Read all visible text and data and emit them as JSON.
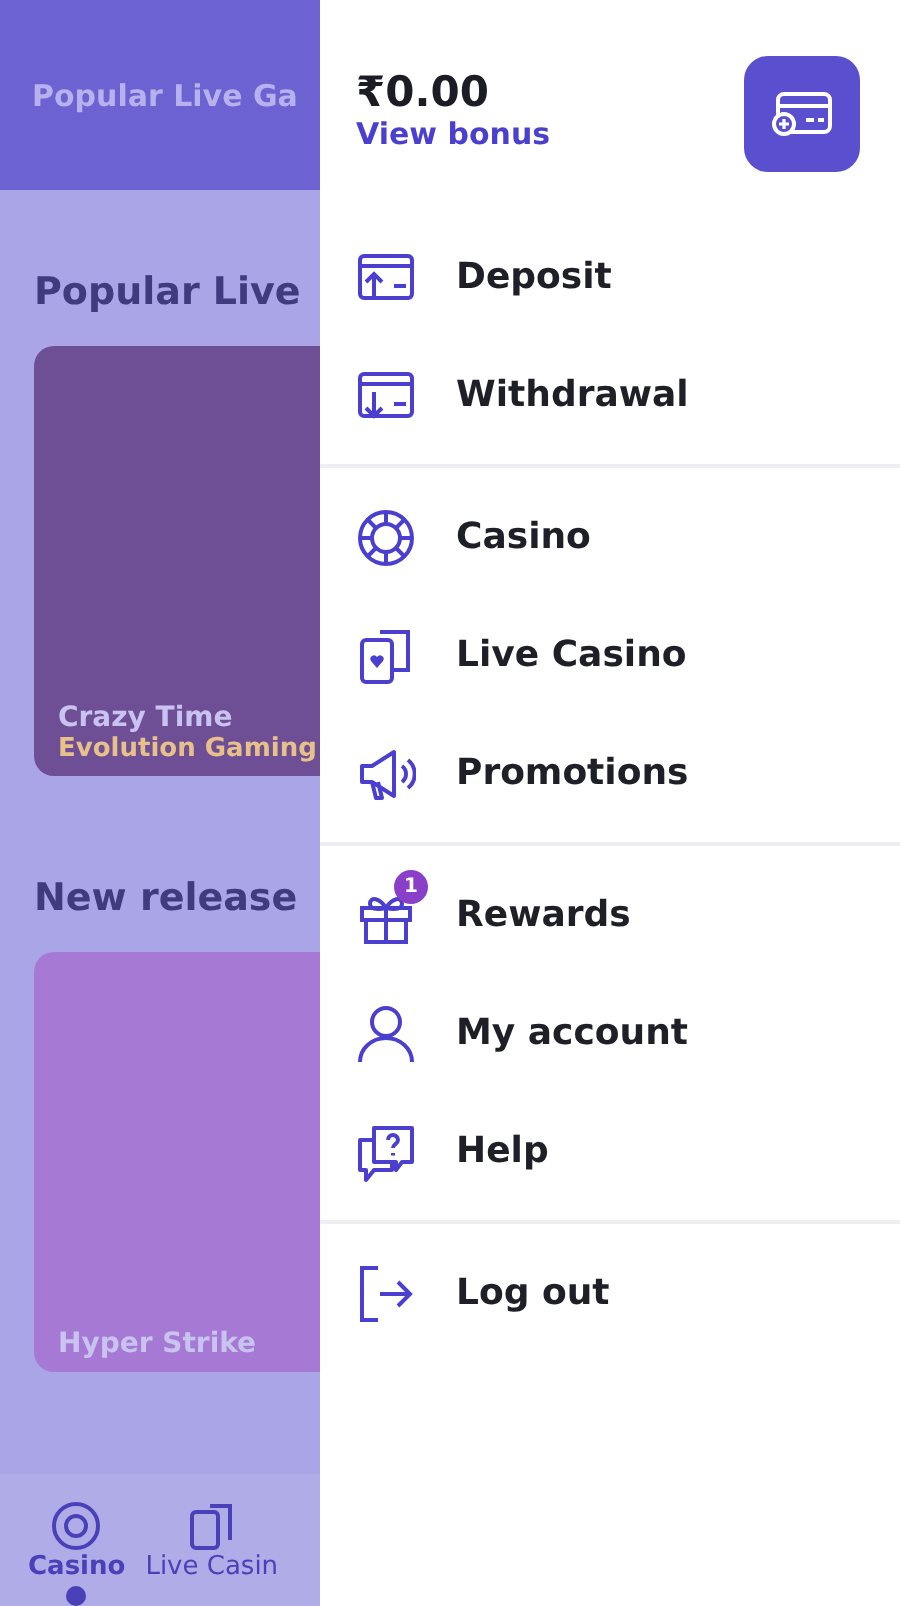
{
  "background_page": {
    "header_title": "Popular Live Ga",
    "sections": [
      {
        "title": "Popular Live",
        "game": {
          "name": "Crazy Time",
          "provider": "Evolution Gaming"
        }
      },
      {
        "title": "New release",
        "game": {
          "name": "Hyper Strike"
        }
      }
    ],
    "bottom_nav": [
      {
        "label": "Casino",
        "selected": true
      },
      {
        "label": "Live Casin",
        "selected": false
      }
    ]
  },
  "drawer": {
    "balance": "₹0.00",
    "view_bonus": "View bonus",
    "groups": [
      [
        {
          "label": "Deposit"
        },
        {
          "label": "Withdrawal"
        }
      ],
      [
        {
          "label": "Casino"
        },
        {
          "label": "Live Casino"
        },
        {
          "label": "Promotions"
        }
      ],
      [
        {
          "label": "Rewards",
          "badge": "1"
        },
        {
          "label": "My account"
        },
        {
          "label": "Help"
        }
      ],
      [
        {
          "label": "Log out"
        }
      ]
    ]
  }
}
